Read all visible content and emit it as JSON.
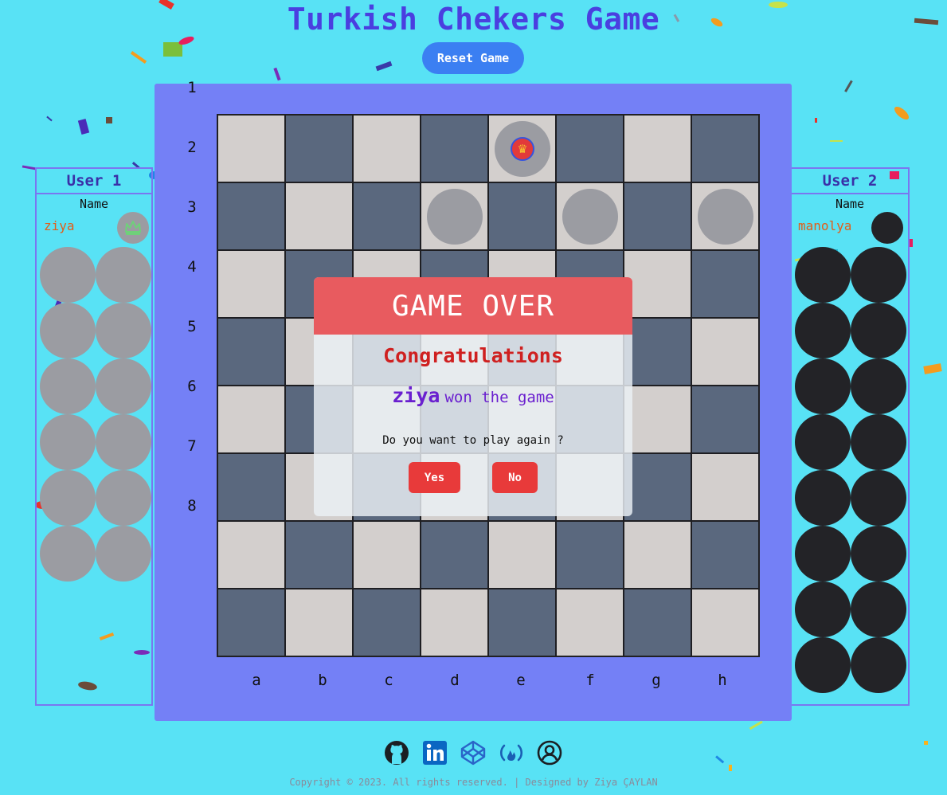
{
  "title": "Turkish Chekers Game",
  "reset_label": "Reset Game",
  "user1": {
    "header": "User 1",
    "name_label": "Name",
    "player_name": "ziya",
    "turn_indicator_icon": "crown-icon",
    "captured_pieces": 12,
    "piece_color": "#9b9ca2"
  },
  "user2": {
    "header": "User 2",
    "name_label": "Name",
    "player_name": "manolya",
    "captured_pieces": 16,
    "piece_color": "#232327"
  },
  "board": {
    "ranks": [
      "1",
      "2",
      "3",
      "4",
      "5",
      "6",
      "7",
      "8"
    ],
    "files": [
      "a",
      "b",
      "c",
      "d",
      "e",
      "f",
      "g",
      "h"
    ],
    "pieces": [
      {
        "square": "e1",
        "color": "grey",
        "king": true
      },
      {
        "square": "d2",
        "color": "grey",
        "king": false
      },
      {
        "square": "f2",
        "color": "grey",
        "king": false
      },
      {
        "square": "h2",
        "color": "grey",
        "king": false
      }
    ],
    "light_color": "#d3cfcd",
    "dark_color": "#5a687e"
  },
  "modal": {
    "title": "GAME OVER",
    "congrats": "Congratulations",
    "winner": "ziya",
    "won_text": "won the game",
    "question": "Do you want to play again ?",
    "yes_label": "Yes",
    "no_label": "No"
  },
  "footer": {
    "icons": [
      "github-icon",
      "linkedin-icon",
      "codepen-icon",
      "freecodecamp-icon",
      "user-circle-icon"
    ],
    "copyright": "Copyright © 2023. All rights reserved. | Designed by Ziya ÇAYLAN"
  },
  "colors": {
    "background": "#58e2f5",
    "title": "#4a3fe0",
    "reset_button": "#3b7ff2",
    "board_panel": "#7480f6",
    "modal_header": "#e85b5f",
    "modal_button": "#e83a3a"
  }
}
